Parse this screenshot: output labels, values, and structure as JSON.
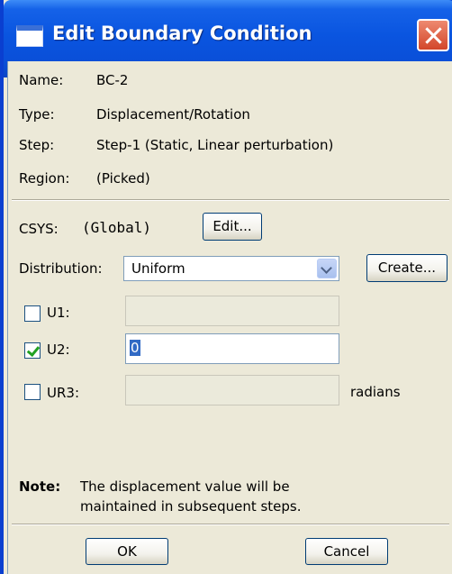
{
  "window": {
    "title": "Edit Boundary Condition"
  },
  "info": {
    "name_label": "Name:",
    "name_value": "BC-2",
    "type_label": "Type:",
    "type_value": "Displacement/Rotation",
    "step_label": "Step:",
    "step_value": "Step-1 (Static, Linear perturbation)",
    "region_label": "Region:",
    "region_value": "(Picked)"
  },
  "csys": {
    "label": "CSYS:",
    "value": "(Global)",
    "edit_button": "Edit..."
  },
  "distribution": {
    "label": "Distribution:",
    "selected": "Uniform",
    "create_button": "Create..."
  },
  "dofs": [
    {
      "label": "U1:",
      "checked": false,
      "value": "",
      "enabled": false
    },
    {
      "label": "U2:",
      "checked": true,
      "value": "0",
      "enabled": true
    },
    {
      "label": "UR3:",
      "checked": false,
      "value": "",
      "enabled": false,
      "unit": "radians"
    }
  ],
  "note": {
    "label": "Note:",
    "line1": "The displacement value will be",
    "line2": "maintained in subsequent steps."
  },
  "buttons": {
    "ok": "OK",
    "cancel": "Cancel"
  },
  "colors": {
    "titlebar": "#0a55e0",
    "window_bg": "#ece9d8",
    "selection": "#316ac5"
  }
}
